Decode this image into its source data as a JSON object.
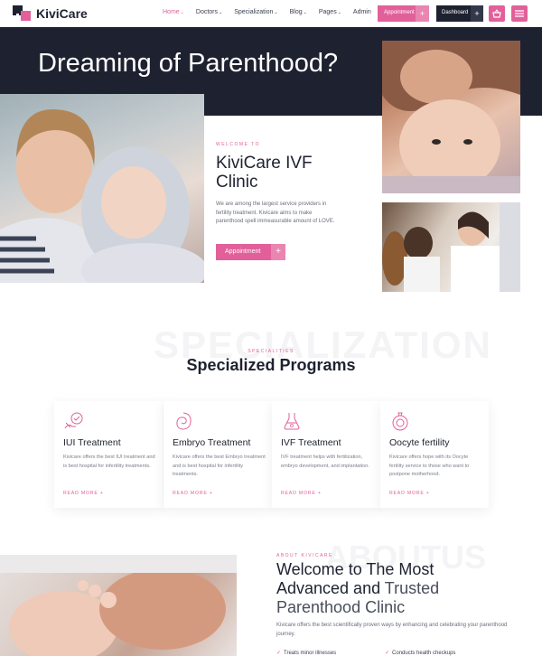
{
  "brand": {
    "name": "KiviCare"
  },
  "nav": {
    "items": [
      {
        "label": "Home",
        "active": true,
        "has_dropdown": true
      },
      {
        "label": "Doctors",
        "has_dropdown": true
      },
      {
        "label": "Specialization",
        "has_dropdown": true
      },
      {
        "label": "Blog",
        "has_dropdown": true
      },
      {
        "label": "Pages",
        "has_dropdown": true
      },
      {
        "label": "Admin",
        "has_dropdown": false
      }
    ],
    "appointment_label": "Appointment",
    "dashboard_label": "Dashboard",
    "plus": "+",
    "cart_icon": "basket-icon",
    "menu_icon": "hamburger-menu-icon"
  },
  "hero": {
    "title": "Dreaming of Parenthood?",
    "tag": "WELCOME TO",
    "clinic_line1": "KiviCare IVF",
    "clinic_line2": "Clinic",
    "description": "We are among the largest service providers in fertility treatment. Kivicare aims to make parenthood spell immeasurable amount of LOVE.",
    "button_label": "Appointment",
    "button_plus": "+"
  },
  "specialization": {
    "watermark": "SPECIALIZATION",
    "tag": "SPECIALITIES",
    "title": "Specialized Programs",
    "cards": [
      {
        "icon": "iui-treatment-icon",
        "title": "IUI Treatment",
        "description": "Kivicare offers the best IUI treatment and is best hospital for infertility treatments.",
        "more": "READ MORE +"
      },
      {
        "icon": "embryo-icon",
        "title": "Embryo Treatment",
        "description": "Kivicare offers the best Embryo treatment and is best hospital for infertility treatments.",
        "more": "READ MORE +"
      },
      {
        "icon": "ivf-flask-icon",
        "title": "IVF Treatment",
        "description": "IVF treatment helps with fertilization, embryo development, and implantation.",
        "more": "READ MORE +"
      },
      {
        "icon": "oocyte-icon",
        "title": "Oocyte fertility",
        "description": "Kivicare offers hope with its Oocyte fertility service to those who want to postpone motherhood.",
        "more": "READ MORE +"
      }
    ]
  },
  "about": {
    "watermark": "ABOUTUS",
    "tag": "ABOUT KIVICARE",
    "title_line1": "Welcome to The Most",
    "title_line2_strong": "Advanced and",
    "title_line2_light": "Trusted",
    "title_line3": "Parenthood Clinic",
    "description": "Kivicare offers the best scientifically proven ways by enhancing and celebrating your parenthood journey.",
    "checks": [
      "Treats minor illnesses",
      "Conducts health checkups"
    ]
  },
  "colors": {
    "accent": "#e2609a",
    "dark": "#1e2230",
    "text_muted": "#6a6e7c"
  }
}
